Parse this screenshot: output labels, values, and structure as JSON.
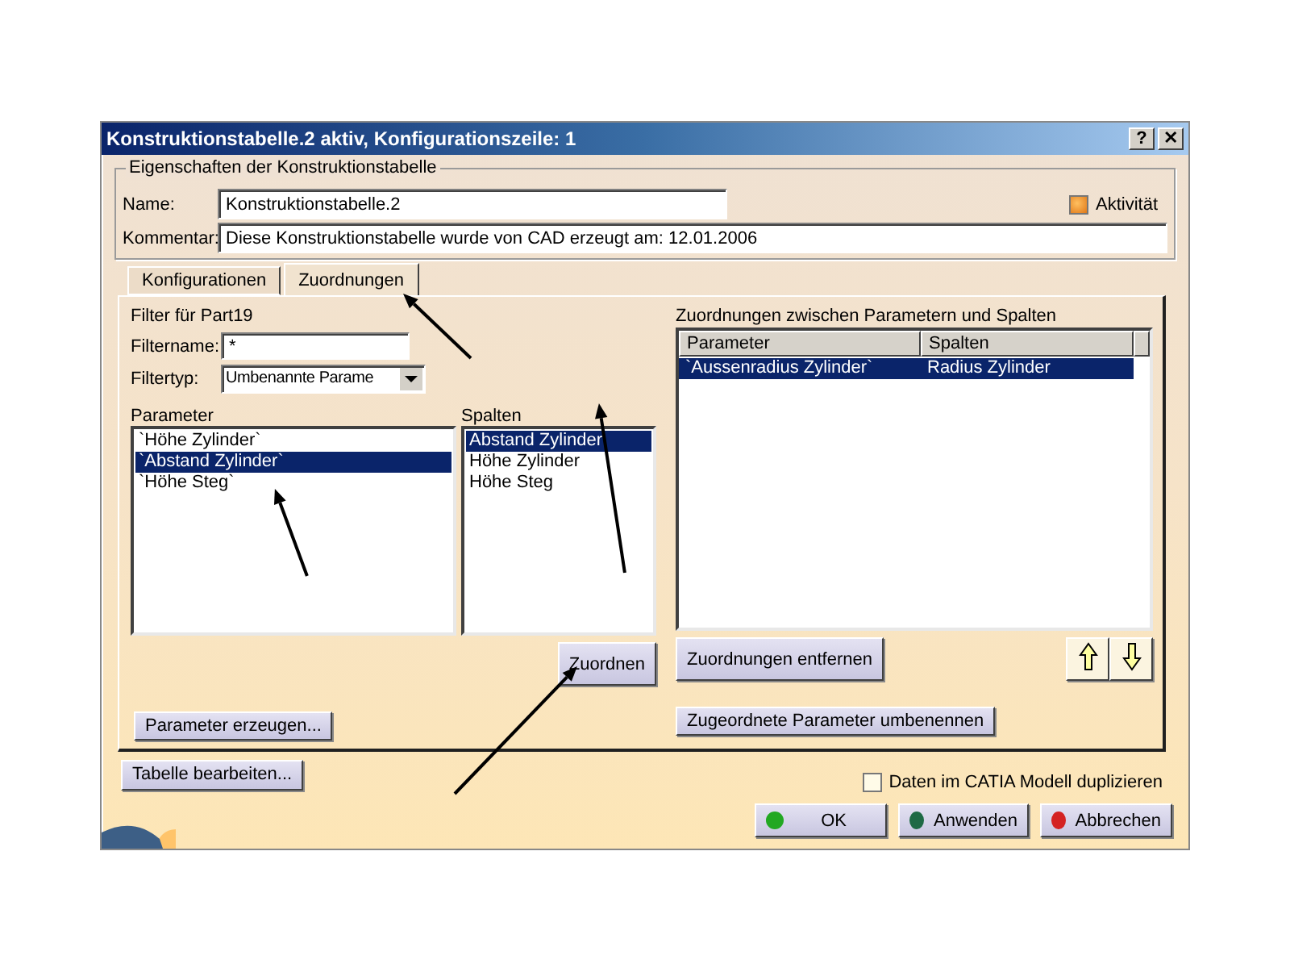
{
  "window": {
    "title": "Konstruktionstabelle.2 aktiv, Konfigurationszeile: 1",
    "help_button": "?",
    "close_button": "✕"
  },
  "properties": {
    "legend": "Eigenschaften der Konstruktionstabelle",
    "name_label": "Name:",
    "name_value": "Konstruktionstabelle.2",
    "comment_label": "Kommentar:",
    "comment_value": "Diese Konstruktionstabelle wurde von CAD erzeugt am: 12.01.2006",
    "activity": {
      "label": "Aktivität",
      "checked": true
    }
  },
  "tabs": [
    {
      "label": "Konfigurationen",
      "selected": false
    },
    {
      "label": "Zuordnungen",
      "selected": true
    }
  ],
  "filter": {
    "title": "Filter für Part19",
    "name_label": "Filtername:",
    "name_value": "*",
    "type_label": "Filtertyp:",
    "type_value": "Umbenannte Parame"
  },
  "parameters": {
    "label": "Parameter",
    "items": [
      {
        "text": "`Höhe Zylinder`",
        "selected": false
      },
      {
        "text": "`Abstand Zylinder`",
        "selected": true
      },
      {
        "text": "`Höhe Steg`",
        "selected": false
      }
    ]
  },
  "columns": {
    "label": "Spalten",
    "items": [
      {
        "text": "Abstand Zylinder",
        "selected": true
      },
      {
        "text": "Höhe Zylinder",
        "selected": false
      },
      {
        "text": "Höhe Steg",
        "selected": false
      }
    ]
  },
  "assign_button": "Zuordnen",
  "create_button": "Parameter erzeugen...",
  "mappings": {
    "label": "Zuordnungen zwischen Parametern und Spalten",
    "columns": [
      "Parameter",
      "Spalten"
    ],
    "rows": [
      {
        "cells": [
          "`Aussenradius Zylinder`",
          "Radius Zylinder"
        ],
        "selected": true
      }
    ]
  },
  "remove_button": "Zuordnungen entfernen",
  "rename_button": "Zugeordnete Parameter umbenennen",
  "edit_table_button": "Tabelle bearbeiten...",
  "duplicate": {
    "label": "Daten im CATIA Modell duplizieren",
    "checked": false
  },
  "footer_buttons": [
    {
      "label": "OK",
      "color": "#22a822"
    },
    {
      "label": "Anwenden",
      "color": "#1e6a45"
    },
    {
      "label": "Abbrechen",
      "color": "#d42222"
    }
  ]
}
